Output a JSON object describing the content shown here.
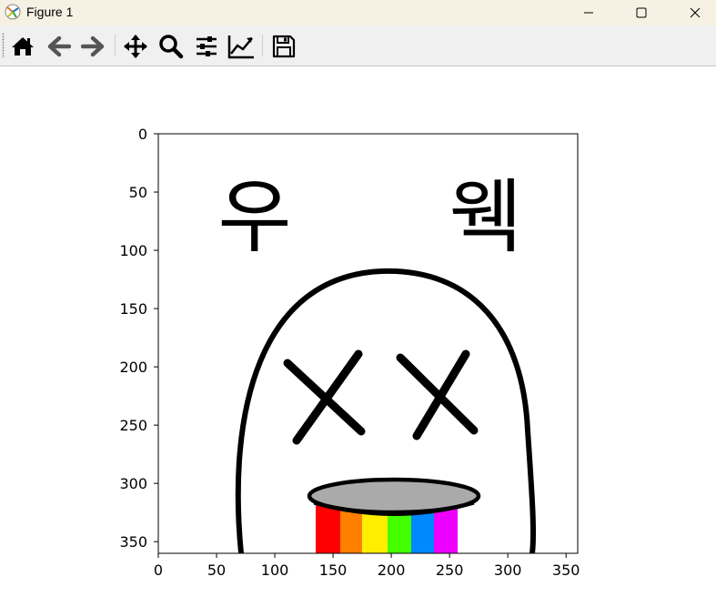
{
  "window": {
    "title": "Figure 1",
    "icon": "matplotlib-icon"
  },
  "window_controls": [
    {
      "name": "minimize-icon"
    },
    {
      "name": "maximize-icon"
    },
    {
      "name": "close-icon"
    }
  ],
  "toolbar": {
    "buttons": [
      {
        "name": "home-icon"
      },
      {
        "name": "back-arrow-icon"
      },
      {
        "name": "forward-arrow-icon"
      },
      {
        "name": "pan-move-icon"
      },
      {
        "name": "zoom-magnifier-icon"
      },
      {
        "name": "configure-subplots-icon"
      },
      {
        "name": "edit-axis-icon"
      },
      {
        "name": "save-floppy-icon"
      }
    ]
  },
  "plot": {
    "image_text": {
      "left_word": "우",
      "right_word": "웩"
    },
    "colors": {
      "outline": "#000000",
      "mouth_fill": "#aaaaaa",
      "rainbow": [
        "#ff0000",
        "#ff8000",
        "#ffee00",
        "#44ff00",
        "#0088ff",
        "#ee00ff"
      ]
    }
  },
  "chart_data": {
    "type": "image",
    "title": "",
    "xlabel": "",
    "ylabel": "",
    "xlim": [
      0,
      360
    ],
    "ylim": [
      360,
      0
    ],
    "x_ticks": [
      "0",
      "50",
      "100",
      "150",
      "200",
      "250",
      "300",
      "350"
    ],
    "y_ticks": [
      "0",
      "50",
      "100",
      "150",
      "200",
      "250",
      "300",
      "350"
    ]
  }
}
